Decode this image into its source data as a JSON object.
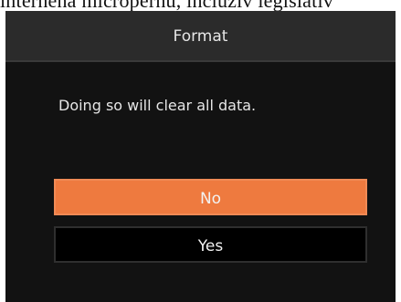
{
  "background_cropped_text": "internena micropernu, incluzív legislativ",
  "dialog": {
    "title": "Format",
    "message": "Doing so will clear all data.",
    "buttons": {
      "no_label": "No",
      "yes_label": "Yes"
    }
  },
  "colors": {
    "dialog_bg": "#121212",
    "header_bg": "#2b2b2b",
    "primary_button": "#ee7a3f",
    "secondary_button": "#000000",
    "text": "#e6e6e6"
  }
}
